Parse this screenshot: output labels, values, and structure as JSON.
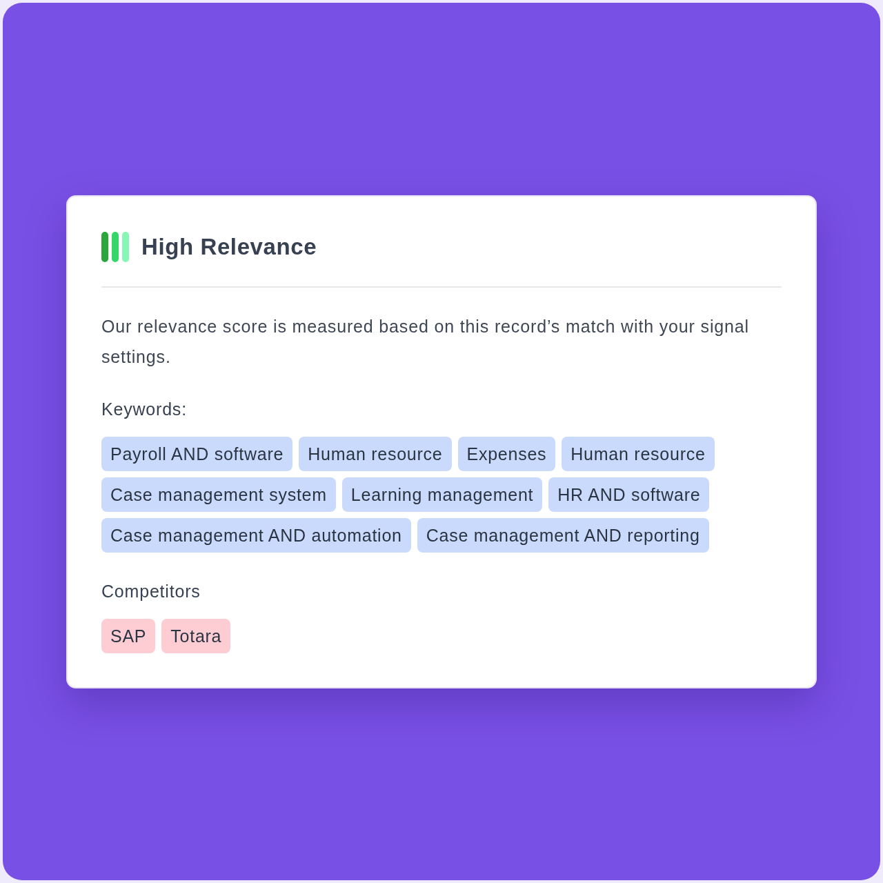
{
  "header": {
    "title": "High Relevance"
  },
  "description": "Our relevance score is measured based on this record’s match with your signal settings.",
  "sections": [
    {
      "label": "Keywords:",
      "kind": "keyword",
      "tags": [
        "Payroll AND software",
        "Human resource",
        "Expenses",
        "Human resource",
        "Case management system",
        "Learning management",
        "HR AND software",
        "Case management AND automation",
        "Case management AND reporting"
      ]
    },
    {
      "label": "Competitors",
      "kind": "competitor",
      "tags": [
        "SAP",
        "Totara"
      ]
    }
  ]
}
